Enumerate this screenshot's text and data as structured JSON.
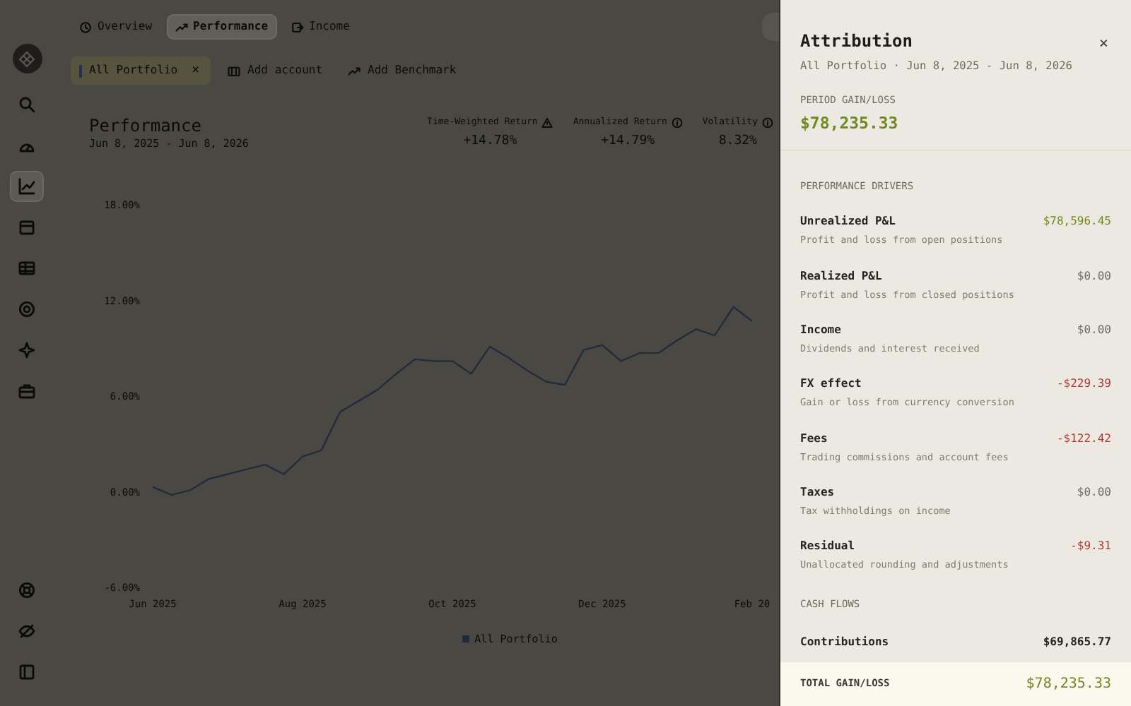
{
  "sidebar": {
    "items": [
      {
        "kind": "search",
        "selected": false
      },
      {
        "kind": "gauge",
        "selected": false
      },
      {
        "kind": "chart",
        "selected": true
      },
      {
        "kind": "calendar",
        "selected": false
      },
      {
        "kind": "table",
        "selected": false
      },
      {
        "kind": "target",
        "selected": false
      },
      {
        "kind": "sparkle",
        "selected": false
      },
      {
        "kind": "briefcase",
        "selected": false
      }
    ],
    "bottom_items": [
      {
        "kind": "lifebuoy"
      },
      {
        "kind": "eye-off"
      },
      {
        "kind": "panel"
      }
    ]
  },
  "tabs": [
    {
      "label": "Overview",
      "selected": false
    },
    {
      "label": "Performance",
      "selected": true
    },
    {
      "label": "Income",
      "selected": false
    }
  ],
  "filters": [
    {
      "label": "All Portfolio",
      "kind": "chip",
      "remove": "×"
    },
    {
      "label": "Add account",
      "kind": "account"
    },
    {
      "label": "Add Benchmark",
      "kind": "benchmark"
    }
  ],
  "performance": {
    "title": "Performance",
    "date_range": "Jun 8, 2025 - Jun 8, 2026",
    "stats": [
      {
        "label": "Time-Weighted Return",
        "value": "+14.78%"
      },
      {
        "label": "Annualized Return",
        "value": "+14.79%"
      },
      {
        "label": "Volatility",
        "value": "8.32%"
      }
    ],
    "chart_data": {
      "type": "line",
      "categories": [
        "Jun 2025",
        null,
        null,
        null,
        null,
        null,
        null,
        null,
        "Aug 2025",
        null,
        null,
        null,
        null,
        null,
        null,
        null,
        "Oct 2025",
        null,
        null,
        null,
        null,
        null,
        null,
        null,
        "Dec 2025",
        null,
        null,
        null,
        null,
        null,
        null,
        null,
        "Feb 20"
      ],
      "series": [
        {
          "name": "All Portfolio",
          "color": "#1f2a3c",
          "values": [
            0.3,
            -0.2,
            0.1,
            0.8,
            1.1,
            1.4,
            1.7,
            1.1,
            2.2,
            2.6,
            5.0,
            5.7,
            6.4,
            7.4,
            8.3,
            8.2,
            8.2,
            7.4,
            9.1,
            8.4,
            7.6,
            6.9,
            6.7,
            8.9,
            9.2,
            8.2,
            8.7,
            8.7,
            9.5,
            10.2,
            9.8,
            11.6,
            10.7
          ]
        }
      ],
      "ylim": [
        -6,
        18
      ],
      "yticks": [
        {
          "value": 18,
          "label": "18.00%"
        },
        {
          "value": 12,
          "label": "12.00%"
        },
        {
          "value": 6,
          "label": "6.00%"
        },
        {
          "value": 0,
          "label": "0.00%"
        },
        {
          "value": -6,
          "label": "-6.00%"
        }
      ]
    }
  },
  "attribution": {
    "title": "Attribution",
    "close": "×",
    "subtitle": "All Portfolio · Jun 8, 2025 - Jun 8, 2026",
    "period_label": "PERIOD GAIN/LOSS",
    "period_value": "$78,235.33",
    "drivers_heading": "PERFORMANCE DRIVERS",
    "drivers": [
      {
        "name": "Unrealized P&L",
        "description": "Profit and loss from open positions",
        "value": "$78,596.45",
        "color": "#6f8a1f"
      },
      {
        "name": "Realized P&L",
        "description": "Profit and loss from closed positions",
        "value": "$0.00",
        "color": "#6b6a66"
      },
      {
        "name": "Income",
        "description": "Dividends and interest received",
        "value": "$0.00",
        "color": "#6b6a66"
      },
      {
        "name": "FX effect",
        "description": "Gain or loss from currency conversion",
        "value": "-$229.39",
        "color": "#b03a32"
      },
      {
        "name": "Fees",
        "description": "Trading commissions and account fees",
        "value": "-$122.42",
        "color": "#b03a32"
      },
      {
        "name": "Taxes",
        "description": "Tax withholdings on income",
        "value": "$0.00",
        "color": "#6b6a66"
      },
      {
        "name": "Residual",
        "description": "Unallocated rounding and adjustments",
        "value": "-$9.31",
        "color": "#b03a32"
      }
    ],
    "cash_flows_heading": "CASH FLOWS",
    "cash_flows": [
      {
        "name": "Contributions",
        "value": "$69,865.77"
      }
    ],
    "total_label": "TOTAL GAIN/LOSS",
    "total_value": "$78,235.33"
  }
}
